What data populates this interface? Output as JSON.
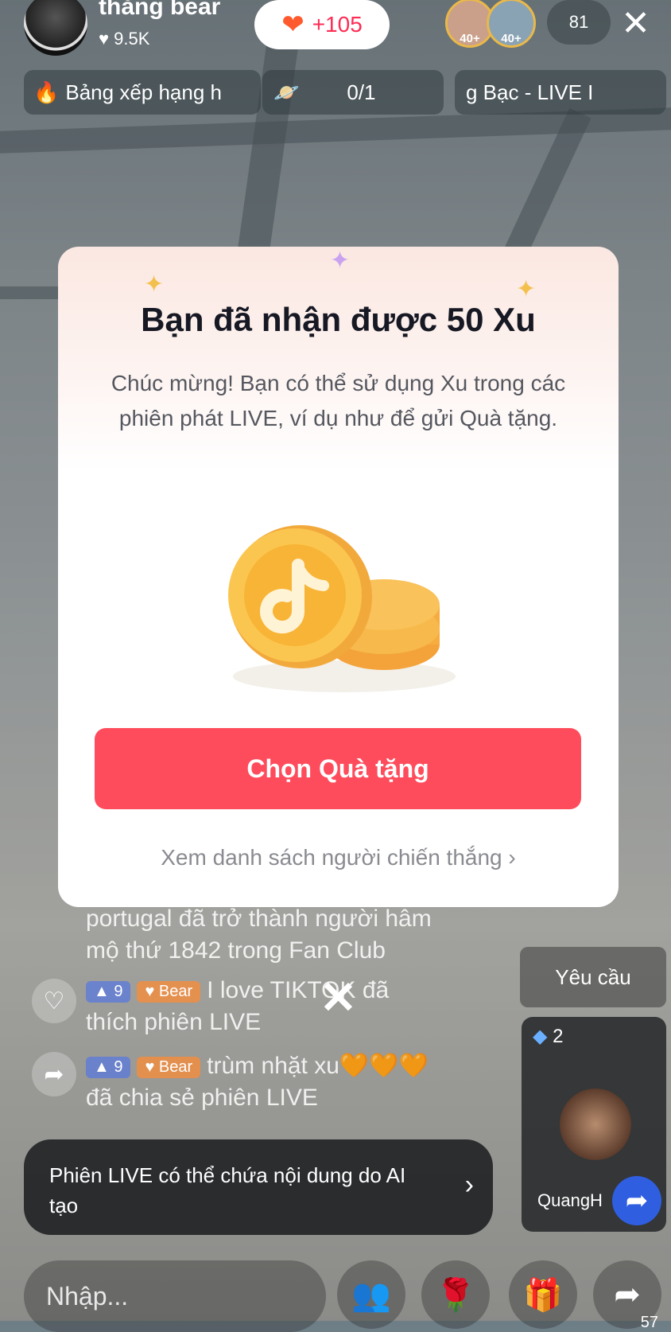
{
  "host": {
    "name": "thắng bear",
    "likes": "♥ 9.5K"
  },
  "follow_button": {
    "label": "+105"
  },
  "viewers": {
    "badge_1": "40+",
    "badge_2": "40+",
    "count": "81"
  },
  "ranking_chip": {
    "label": "Bảng xếp hạng h"
  },
  "goal_chip": {
    "label": "0/1"
  },
  "event_chip": {
    "label": "g Bạc - LIVE I"
  },
  "modal": {
    "title": "Bạn đã nhận được 50 Xu",
    "description": "Chúc mừng! Bạn có thể sử dụng Xu trong các phiên phát LIVE, ví dụ như để gửi Quà tặng.",
    "primary_button": "Chọn Quà tặng",
    "link": "Xem danh sách người chiến thắng"
  },
  "chat": {
    "line1": "portugal đã trở thành người hâm",
    "line2": "mộ thứ 1842 trong Fan Club",
    "msg2": {
      "level": "9",
      "fan": "Bear",
      "user": "I love TIKTOK",
      "text": "đã",
      "text2": "thích phiên LIVE"
    },
    "msg3": {
      "level": "9",
      "fan": "Bear",
      "user": "trùm nhặt xu🧡🧡🧡",
      "text2": "đã chia sẻ phiên LIVE"
    }
  },
  "request_button": "Yêu cầu",
  "guest": {
    "number": "2",
    "name": "QuangH"
  },
  "ai_notice": "Phiên LIVE có thể chứa nội dung do AI tạo",
  "input": {
    "placeholder": "Nhập..."
  },
  "share_count": "57",
  "colors": {
    "accent": "#fe4c5c",
    "brand": "#fe2c55"
  }
}
